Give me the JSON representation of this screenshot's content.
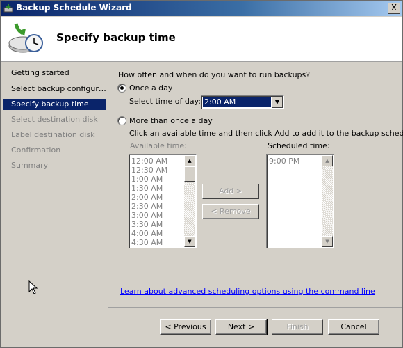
{
  "window": {
    "title": "Backup Schedule Wizard",
    "close_label": "X"
  },
  "header": {
    "title": "Specify backup time",
    "icon": "backup-clock-icon"
  },
  "sidebar": {
    "steps": [
      {
        "label": "Getting started",
        "state": "done"
      },
      {
        "label": "Select backup configur…",
        "state": "done"
      },
      {
        "label": "Specify backup time",
        "state": "active"
      },
      {
        "label": "Select destination disk",
        "state": "pending"
      },
      {
        "label": "Label destination disk",
        "state": "pending"
      },
      {
        "label": "Confirmation",
        "state": "pending"
      },
      {
        "label": "Summary",
        "state": "pending"
      }
    ]
  },
  "main": {
    "question": "How often and when do you want to run backups?",
    "once": {
      "label": "Once a day",
      "selected": true
    },
    "time_label": "Select time of day:",
    "time_value": "2:00 AM",
    "more": {
      "label": "More than once a day",
      "selected": false
    },
    "instructions": "Click an available time and then click Add to add it to the backup schedule.",
    "available_label": "Available time:",
    "available_times": [
      "12:00 AM",
      "12:30 AM",
      "1:00 AM",
      "1:30 AM",
      "2:00 AM",
      "2:30 AM",
      "3:00 AM",
      "3:30 AM",
      "4:00 AM",
      "4:30 AM"
    ],
    "add_label": "Add >",
    "remove_label": "< Remove",
    "scheduled_label": "Scheduled time:",
    "scheduled_times": [
      "9:00 PM"
    ],
    "link": "Learn about advanced scheduling options using the command line"
  },
  "buttons": {
    "previous": "< Previous",
    "next": "Next >",
    "finish": "Finish",
    "cancel": "Cancel"
  },
  "colors": {
    "selection": "#0a246a",
    "face": "#d4d0c8",
    "link": "#0000ff",
    "disabled_text": "#808080"
  }
}
